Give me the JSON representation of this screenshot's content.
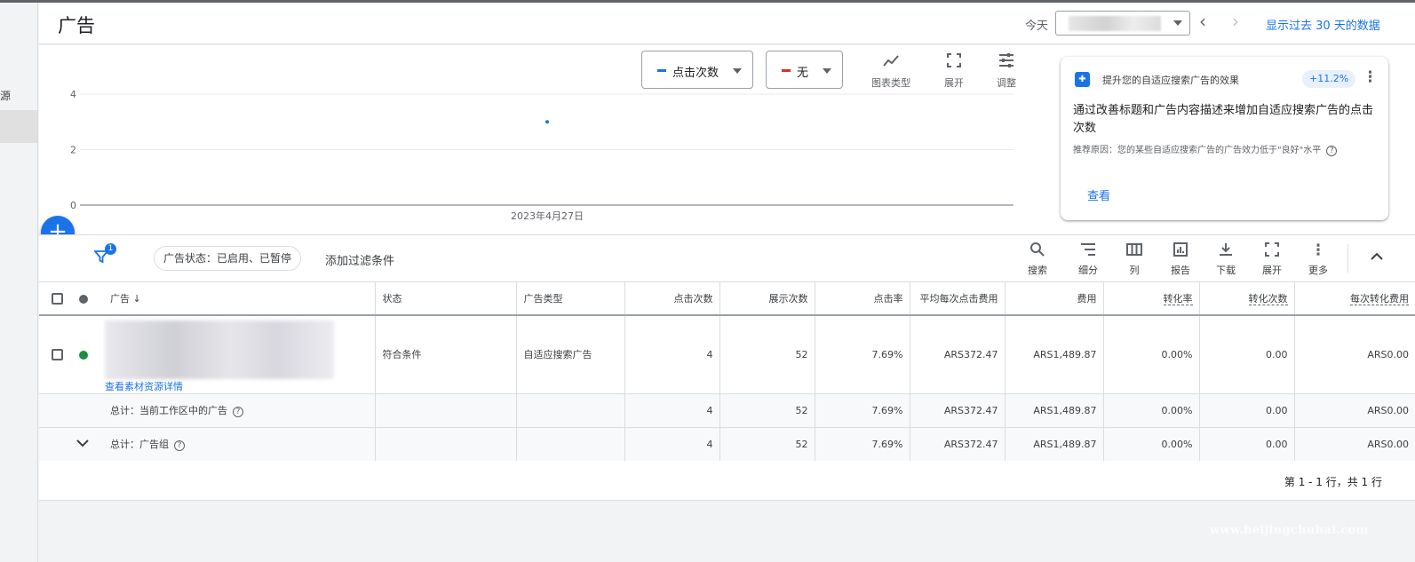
{
  "leftnav": {
    "item_text": "源"
  },
  "header": {
    "title": "广告",
    "today_label": "今天",
    "range_label": "显示过去 30 天的数据"
  },
  "chart_controls": {
    "metric1": {
      "label": "点击次数",
      "color": "#1a73e8"
    },
    "metric2": {
      "label": "无",
      "color": "#d93025"
    },
    "tools": [
      {
        "icon": "trend-line-icon",
        "label": "图表类型"
      },
      {
        "icon": "fullscreen-icon",
        "label": "展开"
      },
      {
        "icon": "tune-icon",
        "label": "调整"
      }
    ]
  },
  "chart_data": {
    "type": "scatter",
    "x": [
      "2023年4月27日"
    ],
    "series": [
      {
        "values": [
          3
        ],
        "color": "#1a73e8"
      }
    ],
    "yticks": [
      "4",
      "2",
      "0"
    ],
    "xtick": "2023年4月27日",
    "ylim": [
      0,
      4
    ],
    "grid": true
  },
  "recommendation": {
    "title": "提升您的自适应搜索广告的效果",
    "badge": "+11.2%",
    "body": "通过改善标题和广告内容描述来增加自适应搜索广告的点击次数",
    "reason": "推荐原因：您的某些自适应搜索广告的广告效力低于\"良好\"水平",
    "action": "查看"
  },
  "filterbar": {
    "filter_count": "1",
    "chip": "广告状态：已启用、已暂停",
    "add_filter": "添加过滤条件",
    "tools": [
      {
        "icon": "search-icon",
        "label": "搜索"
      },
      {
        "icon": "segment-icon",
        "label": "细分"
      },
      {
        "icon": "columns-icon",
        "label": "列"
      },
      {
        "icon": "report-icon",
        "label": "报告"
      },
      {
        "icon": "download-icon",
        "label": "下载"
      },
      {
        "icon": "fullscreen-icon",
        "label": "展开"
      },
      {
        "icon": "more-icon",
        "label": "更多"
      }
    ]
  },
  "table": {
    "headers": {
      "ad": "广告",
      "status": "状态",
      "type": "广告类型",
      "clicks": "点击次数",
      "impr": "展示次数",
      "ctr": "点击率",
      "avg_cpc": "平均每次点击费用",
      "cost": "费用",
      "conv_rate": "转化率",
      "conv": "转化次数",
      "cost_conv": "每次转化费用"
    },
    "row": {
      "status_color": "#1e8e3e",
      "asset_link": "查看素材资源详情",
      "status": "符合条件",
      "type": "自适应搜索广告",
      "clicks": "4",
      "impr": "52",
      "ctr": "7.69%",
      "avg_cpc": "ARS372.47",
      "cost": "ARS1,489.87",
      "conv_rate": "0.00%",
      "conv": "0.00",
      "cost_conv": "ARS0.00"
    },
    "total_workspace": {
      "label": "总计：当前工作区中的广告",
      "clicks": "4",
      "impr": "52",
      "ctr": "7.69%",
      "avg_cpc": "ARS372.47",
      "cost": "ARS1,489.87",
      "conv_rate": "0.00%",
      "conv": "0.00",
      "cost_conv": "ARS0.00"
    },
    "total_adgroup": {
      "label": "总计：广告组",
      "clicks": "4",
      "impr": "52",
      "ctr": "7.69%",
      "avg_cpc": "ARS372.47",
      "cost": "ARS1,489.87",
      "conv_rate": "0.00%",
      "conv": "0.00",
      "cost_conv": "ARS0.00"
    }
  },
  "pagination": "第 1 - 1 行，共 1 行",
  "watermark": "www.heijingchuhai.com"
}
